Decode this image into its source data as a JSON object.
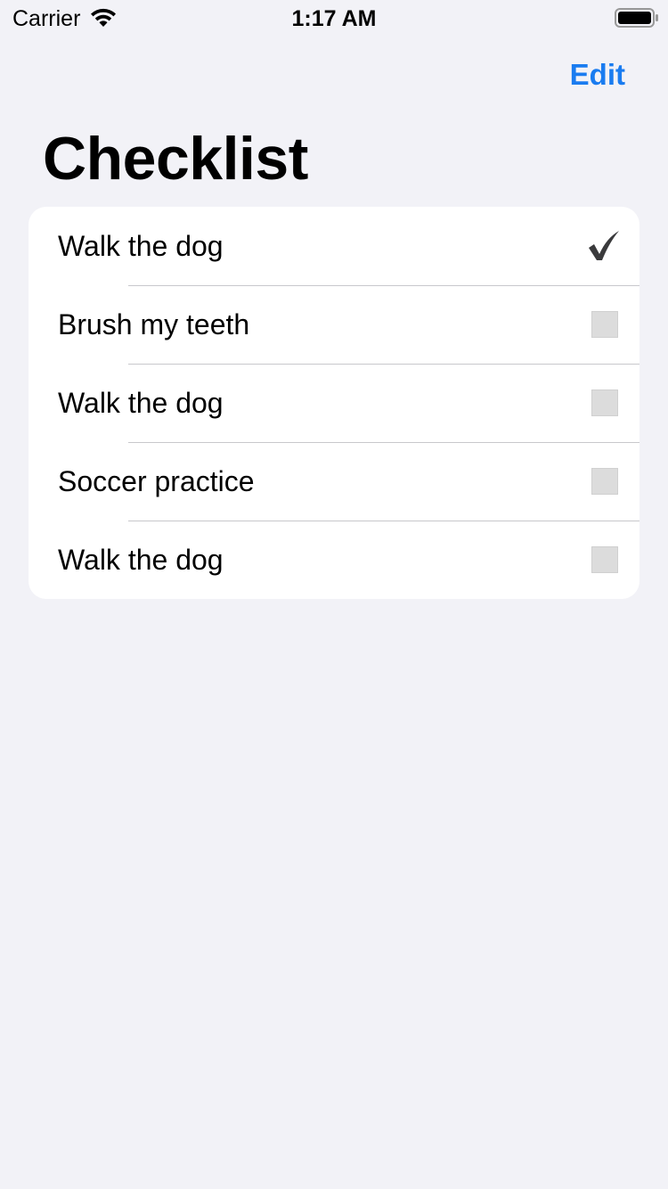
{
  "status_bar": {
    "carrier": "Carrier",
    "time": "1:17 AM"
  },
  "nav": {
    "edit_label": "Edit",
    "title": "Checklist"
  },
  "items": [
    {
      "label": "Walk the dog",
      "checked": true
    },
    {
      "label": "Brush my teeth",
      "checked": false
    },
    {
      "label": "Walk the dog",
      "checked": false
    },
    {
      "label": "Soccer practice",
      "checked": false
    },
    {
      "label": "Walk the dog",
      "checked": false
    }
  ],
  "colors": {
    "accent": "#1a7cf0",
    "background": "#f2f2f7",
    "card": "#ffffff",
    "checkmark": "#3a3a3c",
    "unchecked_box": "#dcdcdc"
  }
}
